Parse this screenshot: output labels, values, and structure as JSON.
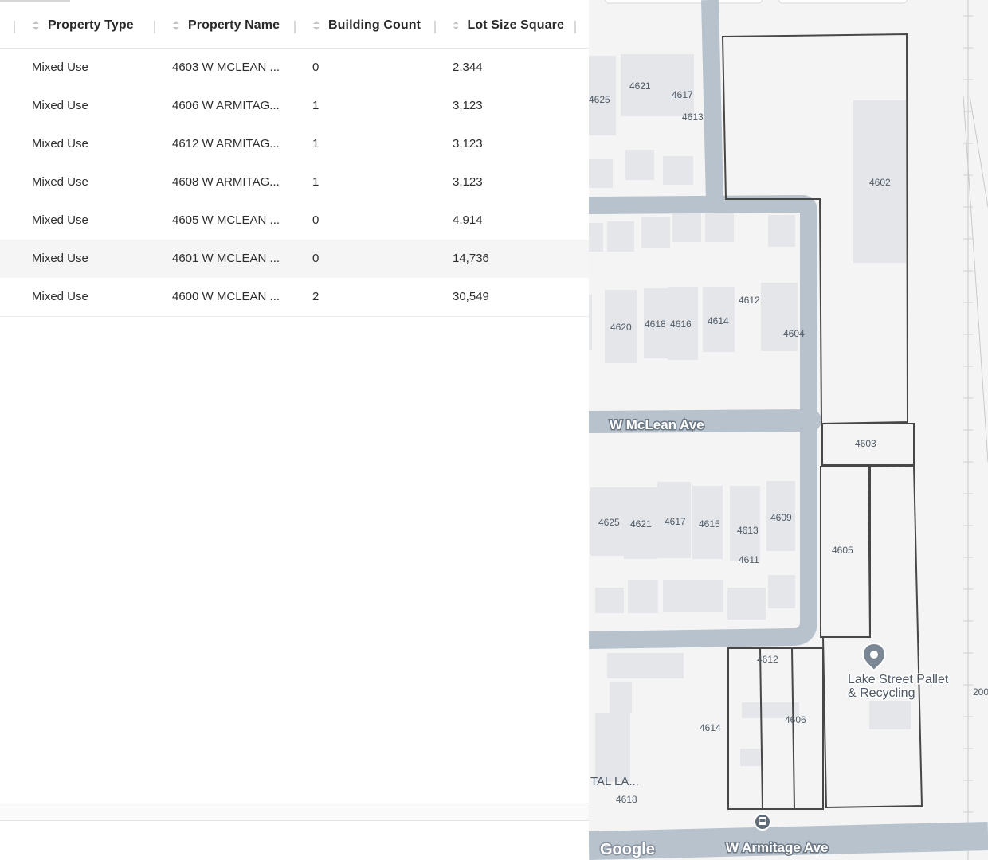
{
  "table": {
    "columns": [
      {
        "key": "type",
        "label": "Property Type"
      },
      {
        "key": "name",
        "label": "Property Name"
      },
      {
        "key": "count",
        "label": "Building Count"
      },
      {
        "key": "lot",
        "label": "Lot Size Square"
      }
    ],
    "rows": [
      {
        "type": "Mixed Use",
        "name": "4603 W MCLEAN ...",
        "count": "0",
        "lot": "2,344"
      },
      {
        "type": "Mixed Use",
        "name": "4606 W ARMITAG...",
        "count": "1",
        "lot": "3,123"
      },
      {
        "type": "Mixed Use",
        "name": "4612 W ARMITAG...",
        "count": "1",
        "lot": "3,123"
      },
      {
        "type": "Mixed Use",
        "name": "4608 W ARMITAG...",
        "count": "1",
        "lot": "3,123"
      },
      {
        "type": "Mixed Use",
        "name": "4605 W MCLEAN ...",
        "count": "0",
        "lot": "4,914"
      },
      {
        "type": "Mixed Use",
        "name": "4601 W MCLEAN ...",
        "count": "0",
        "lot": "14,736"
      },
      {
        "type": "Mixed Use",
        "name": "4600 W MCLEAN ...",
        "count": "2",
        "lot": "30,549"
      }
    ],
    "highlighted_row": 5,
    "sort_icon": "sort-updown-icon"
  },
  "map": {
    "streets": {
      "mclean": "W McLean Ave",
      "armitage": "W Armitage Ave"
    },
    "poi": {
      "line1": "Lake Street Pallet",
      "line2": "& Recycling",
      "icon": "map-pin-icon"
    },
    "lot_labels": {
      "l4625a": "4625",
      "l4621a": "4621",
      "l4617a": "4617",
      "l4613a": "4613",
      "l4602": "4602",
      "l4612a": "4612",
      "l4620": "4620",
      "l4618a": "4618",
      "l4616": "4616",
      "l4614a": "4614",
      "l4604": "4604",
      "l4603": "4603",
      "l4625b": "4625",
      "l4621b": "4621",
      "l4617b": "4617",
      "l4615": "4615",
      "l4613b": "4613",
      "l4609": "4609",
      "l4611": "4611",
      "l4605": "4605",
      "l4612b": "4612",
      "l4614b": "4614",
      "l4606": "4606",
      "l4618b": "4618",
      "l200": "200",
      "ltal": "TAL LA..."
    },
    "google_logo": "Google",
    "bus_stop_icon": "bus-stop-icon",
    "colors": {
      "road": "#b7c2cd",
      "parcel": "#474747",
      "building": "#e5e6ea",
      "background": "#f4f4f4"
    }
  }
}
